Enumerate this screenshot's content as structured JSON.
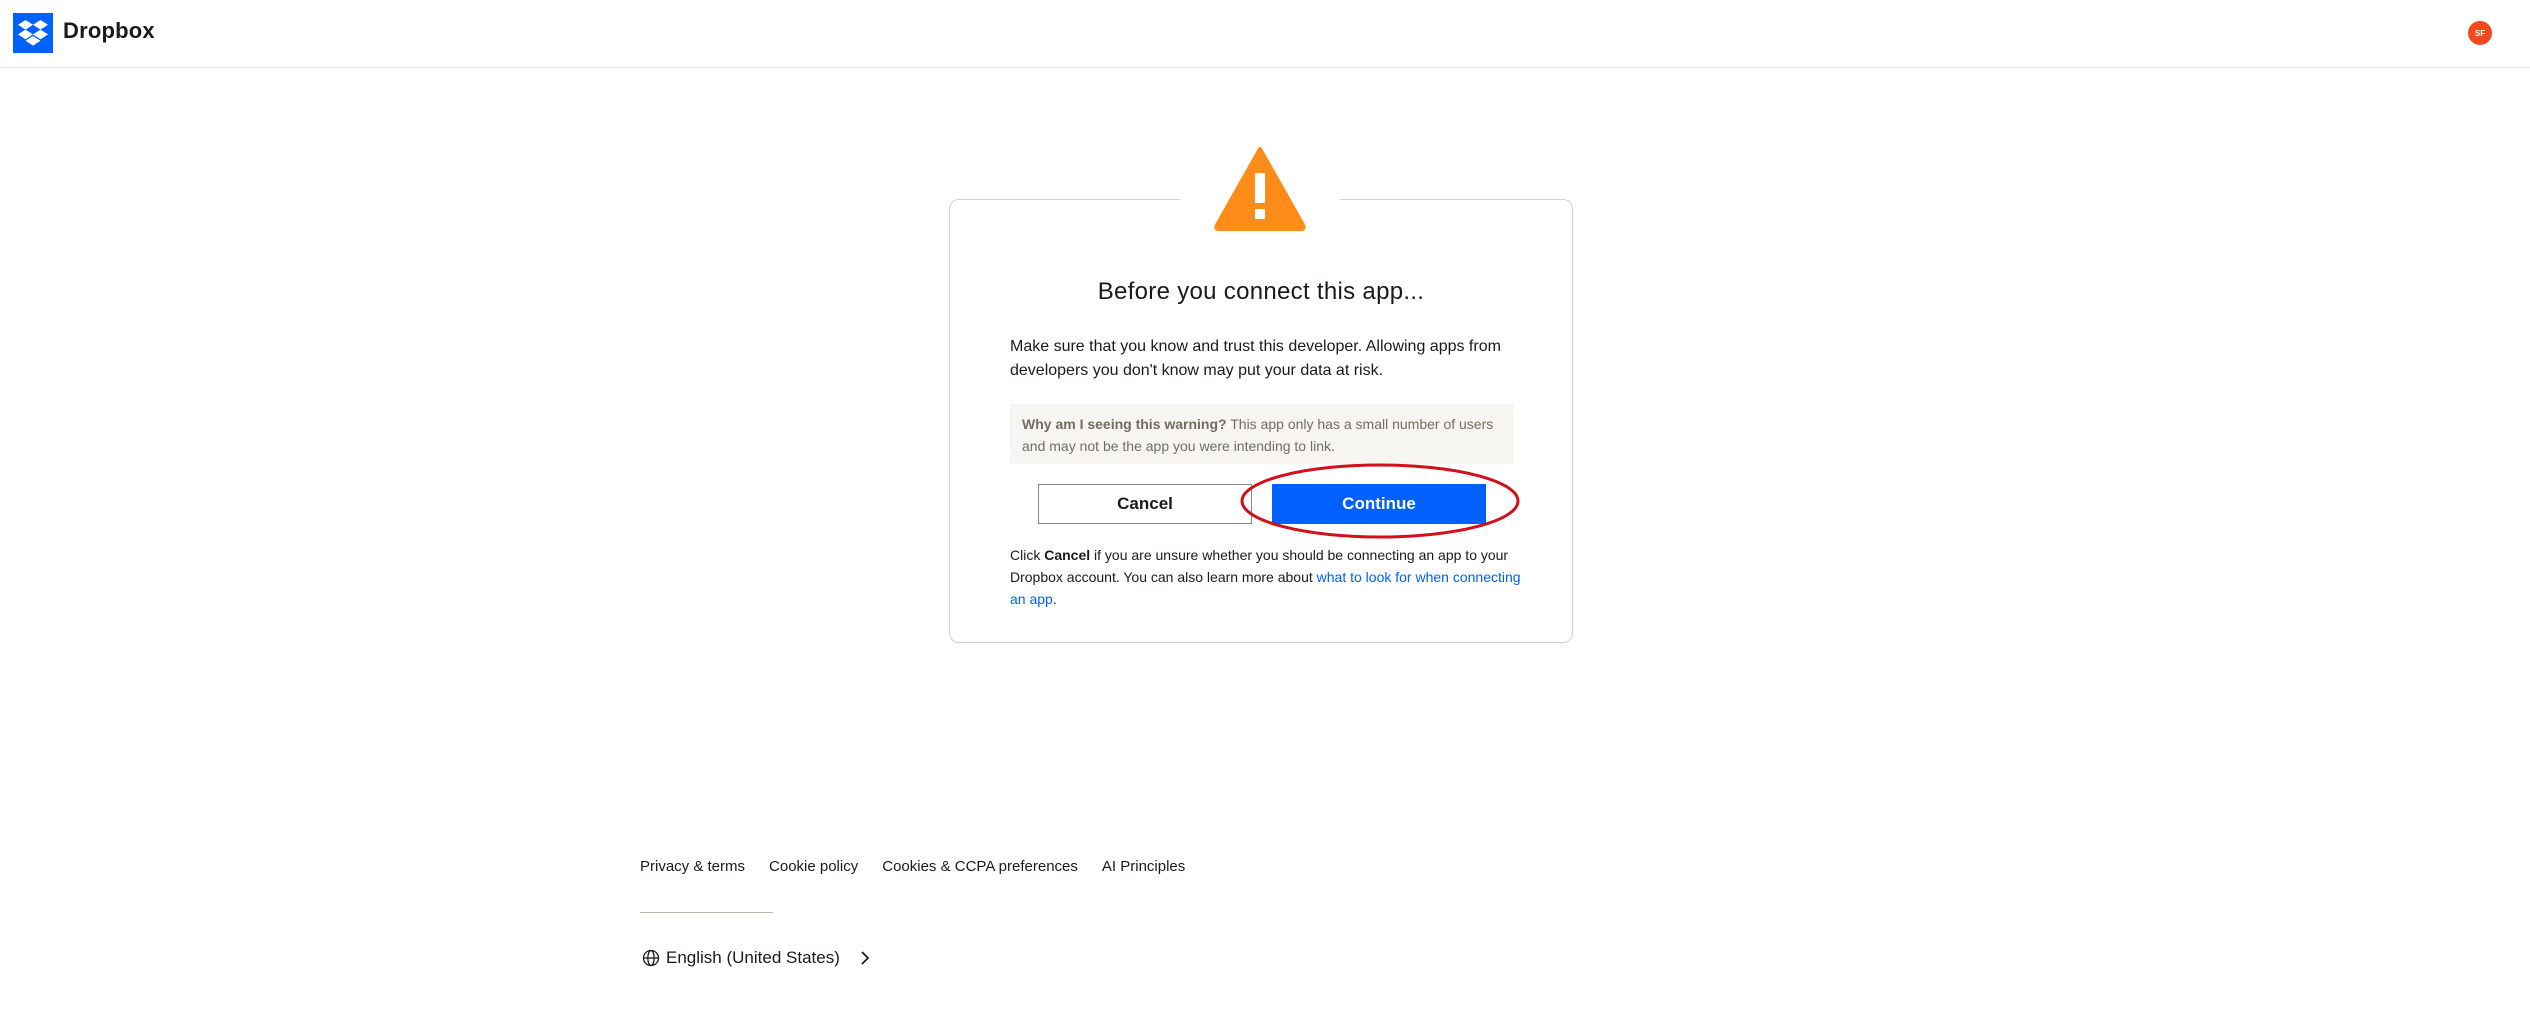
{
  "header": {
    "brand": "Dropbox",
    "avatar_initials": "SF",
    "avatar_color": "#f2491e"
  },
  "dialog": {
    "icon": "warning-triangle-icon",
    "title": "Before you connect this app...",
    "body": "Make sure that you know and trust this developer. Allowing apps from developers you don't know may put your data at risk.",
    "why_heading": "Why am I seeing this warning?",
    "why_text": "This app only has a small number of users and may not be the app you were intending to link.",
    "cancel_label": "Cancel",
    "continue_label": "Continue",
    "foot_prefix": "Click ",
    "foot_cancel": "Cancel",
    "foot_middle": " if you are unsure whether you should be connecting an app to your Dropbox account. You can also learn more about ",
    "foot_link": "what to look for when connecting an app",
    "foot_suffix": "."
  },
  "footer": {
    "links": [
      "Privacy & terms",
      "Cookie policy",
      "Cookies & CCPA preferences",
      "AI Principles"
    ],
    "language": "English (United States)"
  },
  "colors": {
    "brand_blue": "#0061fe",
    "warning_orange": "#ff8c19",
    "highlight_red": "#d0111b"
  }
}
